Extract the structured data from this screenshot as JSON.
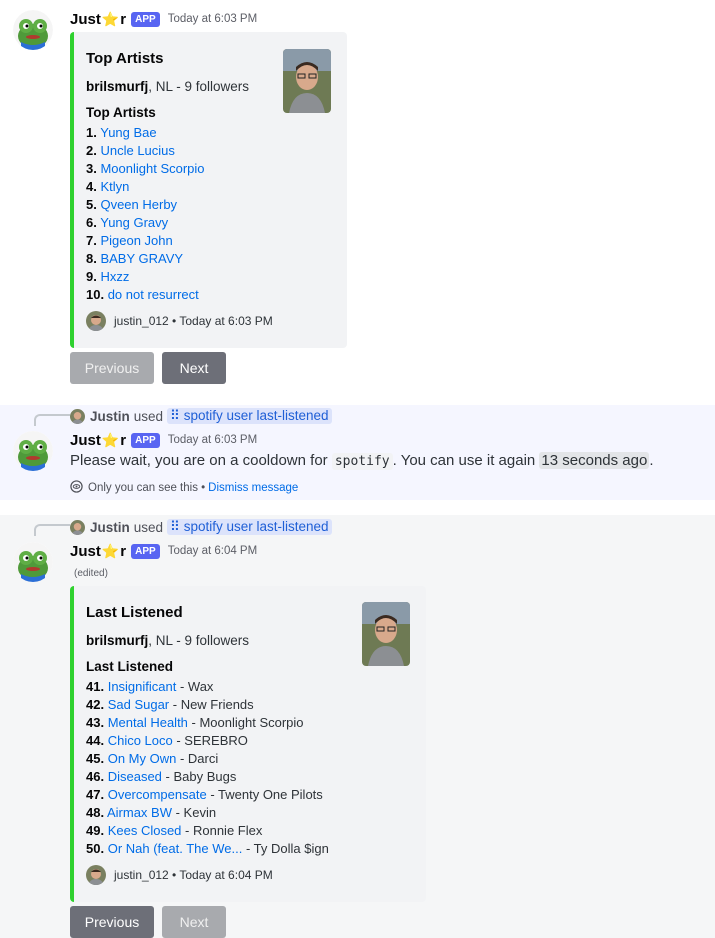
{
  "messages": [
    {
      "author": "Just",
      "author_star": "⭐",
      "author_suffix": "r",
      "badge": "APP",
      "timestamp": "Today at 6:03 PM",
      "embed": {
        "title": "Top Artists",
        "author_name": "brilsmurfj",
        "author_meta": ", NL - 9 followers",
        "field_name": "Top Artists",
        "items": [
          {
            "rank": "1.",
            "name": "Yung Bae",
            "artist": ""
          },
          {
            "rank": "2.",
            "name": "Uncle Lucius",
            "artist": ""
          },
          {
            "rank": "3.",
            "name": "Moonlight Scorpio",
            "artist": ""
          },
          {
            "rank": "4.",
            "name": "Ktlyn",
            "artist": ""
          },
          {
            "rank": "5.",
            "name": "Qveen Herby",
            "artist": ""
          },
          {
            "rank": "6.",
            "name": "Yung Gravy",
            "artist": ""
          },
          {
            "rank": "7.",
            "name": "Pigeon John",
            "artist": ""
          },
          {
            "rank": "8.",
            "name": "BABY GRAVY",
            "artist": ""
          },
          {
            "rank": "9.",
            "name": "Hxzz",
            "artist": ""
          },
          {
            "rank": "10.",
            "name": "do not resurrect",
            "artist": ""
          }
        ],
        "footer": "justin_012 • Today at 6:03 PM"
      },
      "buttons": {
        "previous": "Previous",
        "next": "Next"
      }
    },
    {
      "reply": {
        "name": "Justin",
        "used": "used",
        "command": "spotify user last-listened"
      },
      "author": "Just",
      "author_star": "⭐",
      "author_suffix": "r",
      "badge": "APP",
      "timestamp": "Today at 6:03 PM",
      "text_before": "Please wait, you are on a cooldown for ",
      "text_code": "spotify",
      "text_mid": ". You can use it again ",
      "text_time": "13 seconds ago",
      "text_after": ".",
      "ephemeral": "Only you can see this • ",
      "dismiss": "Dismiss message"
    },
    {
      "reply": {
        "name": "Justin",
        "used": "used",
        "command": "spotify user last-listened"
      },
      "author": "Just",
      "author_star": "⭐",
      "author_suffix": "r",
      "badge": "APP",
      "timestamp": "Today at 6:04 PM",
      "edited": "(edited)",
      "embed": {
        "title": "Last Listened",
        "author_name": "brilsmurfj",
        "author_meta": ", NL - 9 followers",
        "field_name": "Last Listened",
        "items": [
          {
            "rank": "41.",
            "name": "Insignificant",
            "artist": " - Wax"
          },
          {
            "rank": "42.",
            "name": "Sad Sugar",
            "artist": " - New Friends"
          },
          {
            "rank": "43.",
            "name": "Mental Health",
            "artist": " - Moonlight Scorpio"
          },
          {
            "rank": "44.",
            "name": "Chico Loco",
            "artist": " - SEREBRO"
          },
          {
            "rank": "45.",
            "name": "On My Own",
            "artist": " - Darci"
          },
          {
            "rank": "46.",
            "name": "Diseased",
            "artist": " - Baby Bugs"
          },
          {
            "rank": "47.",
            "name": "Overcompensate",
            "artist": " - Twenty One Pilots"
          },
          {
            "rank": "48.",
            "name": "Airmax BW",
            "artist": " - Kevin"
          },
          {
            "rank": "49.",
            "name": "Kees Closed",
            "artist": " - Ronnie Flex"
          },
          {
            "rank": "50.",
            "name": "Or Nah (feat. The We...",
            "artist": " - Ty Dolla $ign"
          }
        ],
        "footer": "justin_012 • Today at 6:04 PM"
      },
      "buttons": {
        "previous": "Previous",
        "next": "Next"
      }
    }
  ],
  "colors": {
    "embed_border": "#2fd12f",
    "link": "#006ce7",
    "app_badge": "#5865f2"
  }
}
